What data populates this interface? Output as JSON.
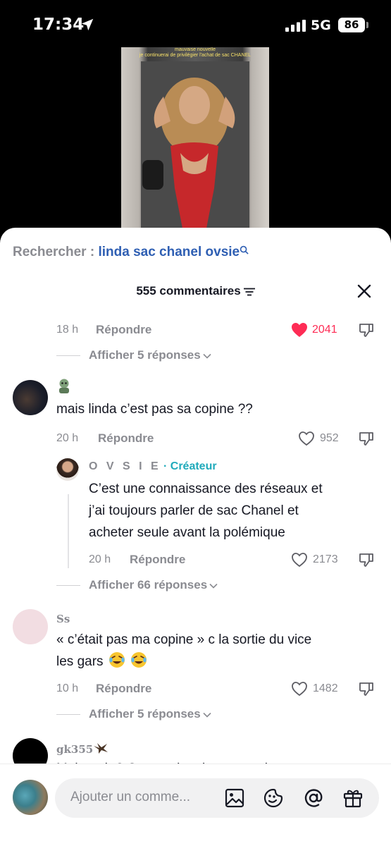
{
  "status": {
    "time": "17:34",
    "network": "5G",
    "battery": "86"
  },
  "video": {
    "caption_line1": "mauvaise nouvelle",
    "caption_line2": "je continuerai de privilégier l'achat de sac CHANEL"
  },
  "search": {
    "label": "Rechercher : ",
    "query": "linda sac chanel ovsie"
  },
  "header": {
    "count_label": "555 commentaires"
  },
  "comments": [
    {
      "time": "18 h",
      "reply": "Répondre",
      "likes": "2041",
      "liked": true,
      "replies_label": "Afficher 5 réponses"
    },
    {
      "username": "",
      "text": "mais linda c’est pas sa copine ??",
      "time": "20 h",
      "reply": "Répondre",
      "likes": "952",
      "liked": false,
      "creator_reply": {
        "username": "O V S I E",
        "badge": "· Créateur",
        "text_lines": [
          "C’est une connaissance des réseaux et",
          "j’ai toujours parler de sac Chanel et",
          "acheter seule avant la polémique"
        ],
        "time": "20 h",
        "reply": "Répondre",
        "likes": "2173"
      },
      "replies_label": "Afficher 66 réponses"
    },
    {
      "username": "Ss",
      "text_line1": "«  c’était pas ma copine » c la sortie du vice",
      "text_line2": "les gars",
      "time": "10 h",
      "reply": "Répondre",
      "likes": "1482",
      "liked": false,
      "replies_label": "Afficher 5 réponses"
    },
    {
      "username": "gk355",
      "text": "Mais wsh ? C ta copine tique a quoi"
    }
  ],
  "input": {
    "placeholder": "Ajouter un comme..."
  },
  "colors": {
    "like_red": "#fe2c55",
    "link_blue": "#2f5fb3",
    "creator_teal": "#20aabb"
  },
  "icons": [
    "location-arrow-icon",
    "signal-icon",
    "search-icon",
    "filter-icon",
    "close-icon",
    "heart-icon",
    "dislike-icon",
    "chevron-down-icon",
    "image-icon",
    "emoji-sticker-icon",
    "mention-icon",
    "gift-icon"
  ]
}
